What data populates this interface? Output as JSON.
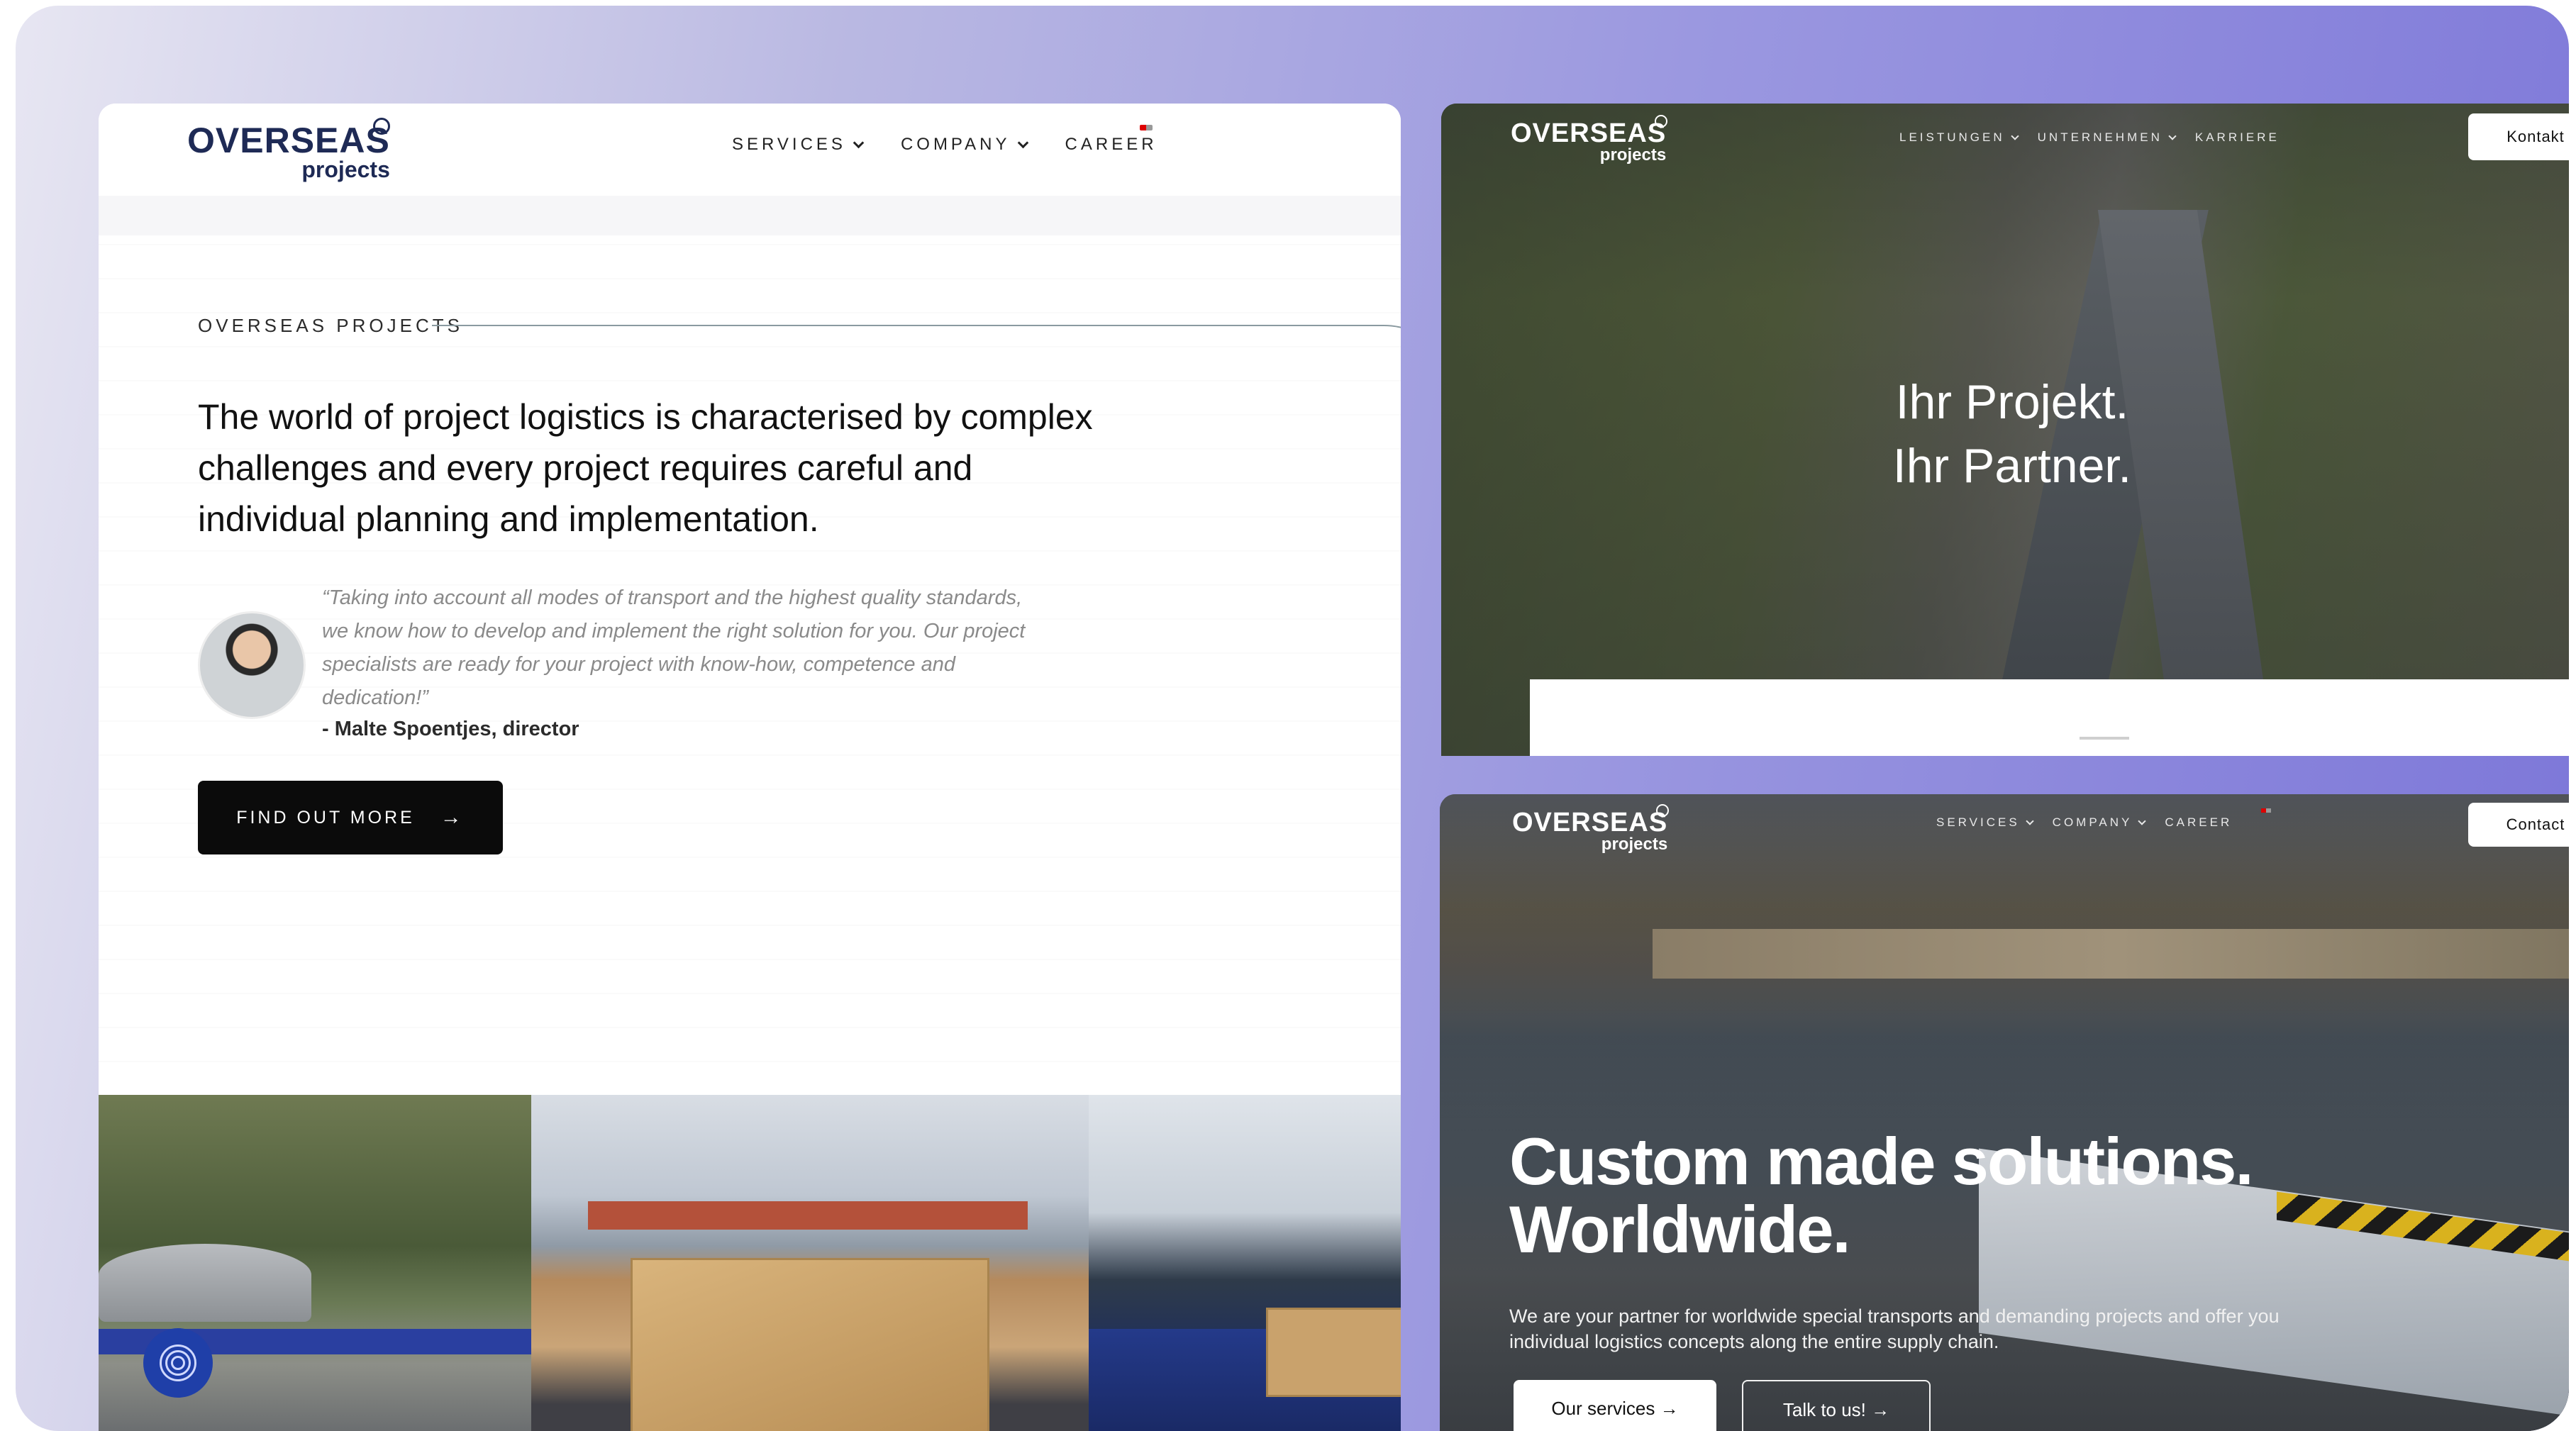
{
  "left_site": {
    "logo": {
      "line1": "OVERSEAS",
      "line2": "projects"
    },
    "nav": {
      "services": "SERVICES",
      "company": "COMPANY",
      "career": "CAREER"
    },
    "eyebrow": "OVERSEAS PROJECTS",
    "headline": "The world of project logistics is characterised by complex challenges and every project requires careful and individual planning and implementation.",
    "quote": "“Taking into account all modes of transport and the highest quality standards, we know how to develop and implement the right solution for you. Our project specialists are ready for your project with know-how, competence and dedication!”",
    "quote_author": "- Malte Spoentjes, director",
    "cta": {
      "label": "FIND OUT MORE",
      "arrow": "→"
    }
  },
  "top_right_site": {
    "logo": {
      "line1": "OVERSEAS",
      "line2": "projects"
    },
    "nav": {
      "item1": "LEISTUNGEN",
      "item2": "UNTERNEHMEN",
      "item3": "KARRIERE"
    },
    "button": "Kontakt",
    "hero_line1": "Ihr Projekt.",
    "hero_line2": "Ihr Partner."
  },
  "bottom_right_site": {
    "logo": {
      "line1": "OVERSEAS",
      "line2": "projects"
    },
    "nav": {
      "item1": "SERVICES",
      "item2": "COMPANY",
      "item3": "CAREER"
    },
    "button": "Contact",
    "hero_line1": "Custom made solutions.",
    "hero_line2": "Worldwide.",
    "subtext": "We are your partner for worldwide special transports and demanding projects and offer you individual logistics concepts along the entire supply chain.",
    "btn_services": "Our services →",
    "btn_talk": "Talk to us! →"
  },
  "colors": {
    "brand_navy": "#1e2a55",
    "frame_gradient_end": "#7b75d8",
    "cta_black": "#0b0b0b",
    "fingerprint_blue": "#1f3fa8"
  },
  "icons": [
    "chevron-down-icon",
    "arrow-right-icon",
    "fingerprint-icon",
    "language-flag-icon"
  ]
}
